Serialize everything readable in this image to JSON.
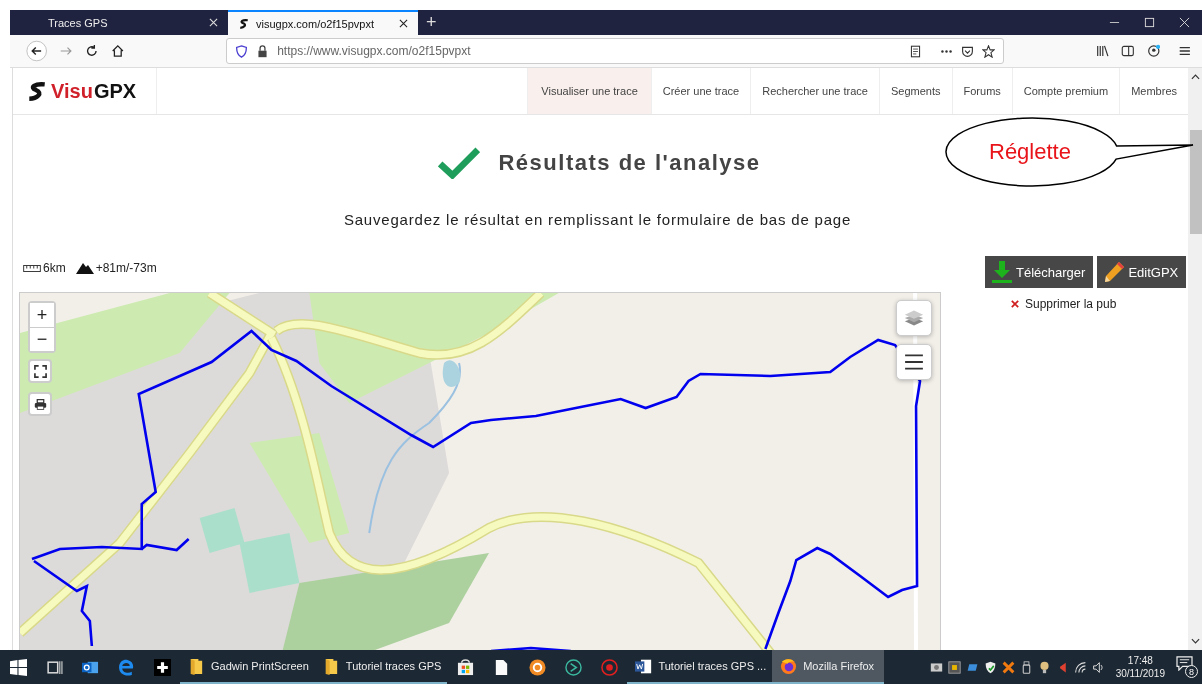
{
  "browser": {
    "tabs": [
      {
        "label": "Traces GPS",
        "selected": false
      },
      {
        "label": "visugpx.com/o2f15pvpxt",
        "selected": true
      }
    ],
    "new_tab": "+",
    "url": "https://www.visugpx.com/o2f15pvpxt"
  },
  "site": {
    "logo": [
      "Visu",
      "GPX"
    ],
    "nav": [
      {
        "label": "Visualiser une trace",
        "selected": true
      },
      {
        "label": "Créer une trace",
        "selected": false
      },
      {
        "label": "Rechercher une trace",
        "selected": false
      },
      {
        "label": "Segments",
        "selected": false
      },
      {
        "label": "Forums",
        "selected": false
      },
      {
        "label": "Compte premium",
        "selected": false
      },
      {
        "label": "Membres",
        "selected": false
      }
    ]
  },
  "heading": "Résultats de l'analyse",
  "subheading": "Sauvegardez le résultat en remplissant le formulaire de bas de page",
  "stats": {
    "distance": "6km",
    "elevation": "+81m/-73m"
  },
  "actions": [
    {
      "label": "Télécharger",
      "kind": "download"
    },
    {
      "label": "EditGPX",
      "kind": "edit"
    }
  ],
  "remove_ads": "Supprimer la pub",
  "map": {
    "zoom_in": "+",
    "zoom_out": "−"
  },
  "callout": "Réglette",
  "taskbar": {
    "items": [
      {
        "kind": "windows"
      },
      {
        "kind": "taskview"
      },
      {
        "kind": "outlook"
      },
      {
        "kind": "edge"
      },
      {
        "kind": "plus"
      },
      {
        "kind": "folder",
        "label": "Gadwin PrintScreen",
        "selected": false
      },
      {
        "kind": "folder",
        "label": "Tutoriel traces GPS",
        "selected": false
      },
      {
        "kind": "store"
      },
      {
        "kind": "file"
      },
      {
        "kind": "orange"
      },
      {
        "kind": "green"
      },
      {
        "kind": "red"
      },
      {
        "kind": "word",
        "label": "Tutoriel traces GPS ...",
        "selected": false
      },
      {
        "kind": "firefox",
        "label": "Mozilla Firefox",
        "selected": true
      }
    ],
    "time": "17:48",
    "date": "30/11/2019",
    "notifications": "8"
  }
}
